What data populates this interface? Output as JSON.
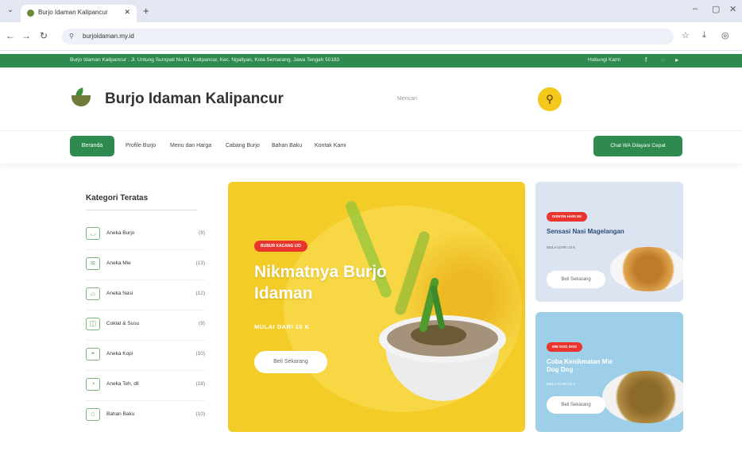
{
  "browser": {
    "tab_title": "Burjo Idaman Kalipancur",
    "url": "burjoidaman.my.id"
  },
  "topbar": {
    "address": "Burjo Idaman Kalipancur : Jl. Untung Suropati No.61, Kalipancur, Kec. Ngaliyan, Kota Semarang, Jawa Tengah 50183",
    "contact_label": "Hubungi Kami"
  },
  "header": {
    "brand": "Burjo Idaman Kalipancur",
    "search_placeholder": "Mencari"
  },
  "nav": {
    "items": [
      "Beranda",
      "Profile Burjo",
      "Menu dan Harga",
      "Cabang Burjo",
      "Bahan Baku",
      "Kontak Kami"
    ],
    "cta": "Chat WA Dilayani Cepat"
  },
  "sidebar": {
    "title": "Kategori Teratas",
    "categories": [
      {
        "name": "Aneka Burjo",
        "count": "(8)"
      },
      {
        "name": "Aneka Mie",
        "count": "(13)"
      },
      {
        "name": "Aneka Nasi",
        "count": "(12)"
      },
      {
        "name": "Coklat & Susu",
        "count": "(9)"
      },
      {
        "name": "Aneka Kopi",
        "count": "(10)"
      },
      {
        "name": "Aneka Teh, dll",
        "count": "(18)"
      },
      {
        "name": "Bahan Baku",
        "count": "(10)"
      }
    ]
  },
  "hero": {
    "badge": "BUBUR KACANG IJO",
    "title": "Nikmatnya Burjo Idaman",
    "subtitle": "MULAI DARI 10 K",
    "button": "Beli Sekarang"
  },
  "promos": [
    {
      "badge": "DISKON HARI INI",
      "title": "Sensasi Nasi Magelangan",
      "sub": "MULAI DARI 10 K",
      "button": "Beli Sekarang"
    },
    {
      "badge": "MIE DOG DOG",
      "title": "Coba Kenikmatan Mie Dog Dog",
      "sub": "MULAI DARI 10 K",
      "button": "Beli Sekarang"
    }
  ]
}
